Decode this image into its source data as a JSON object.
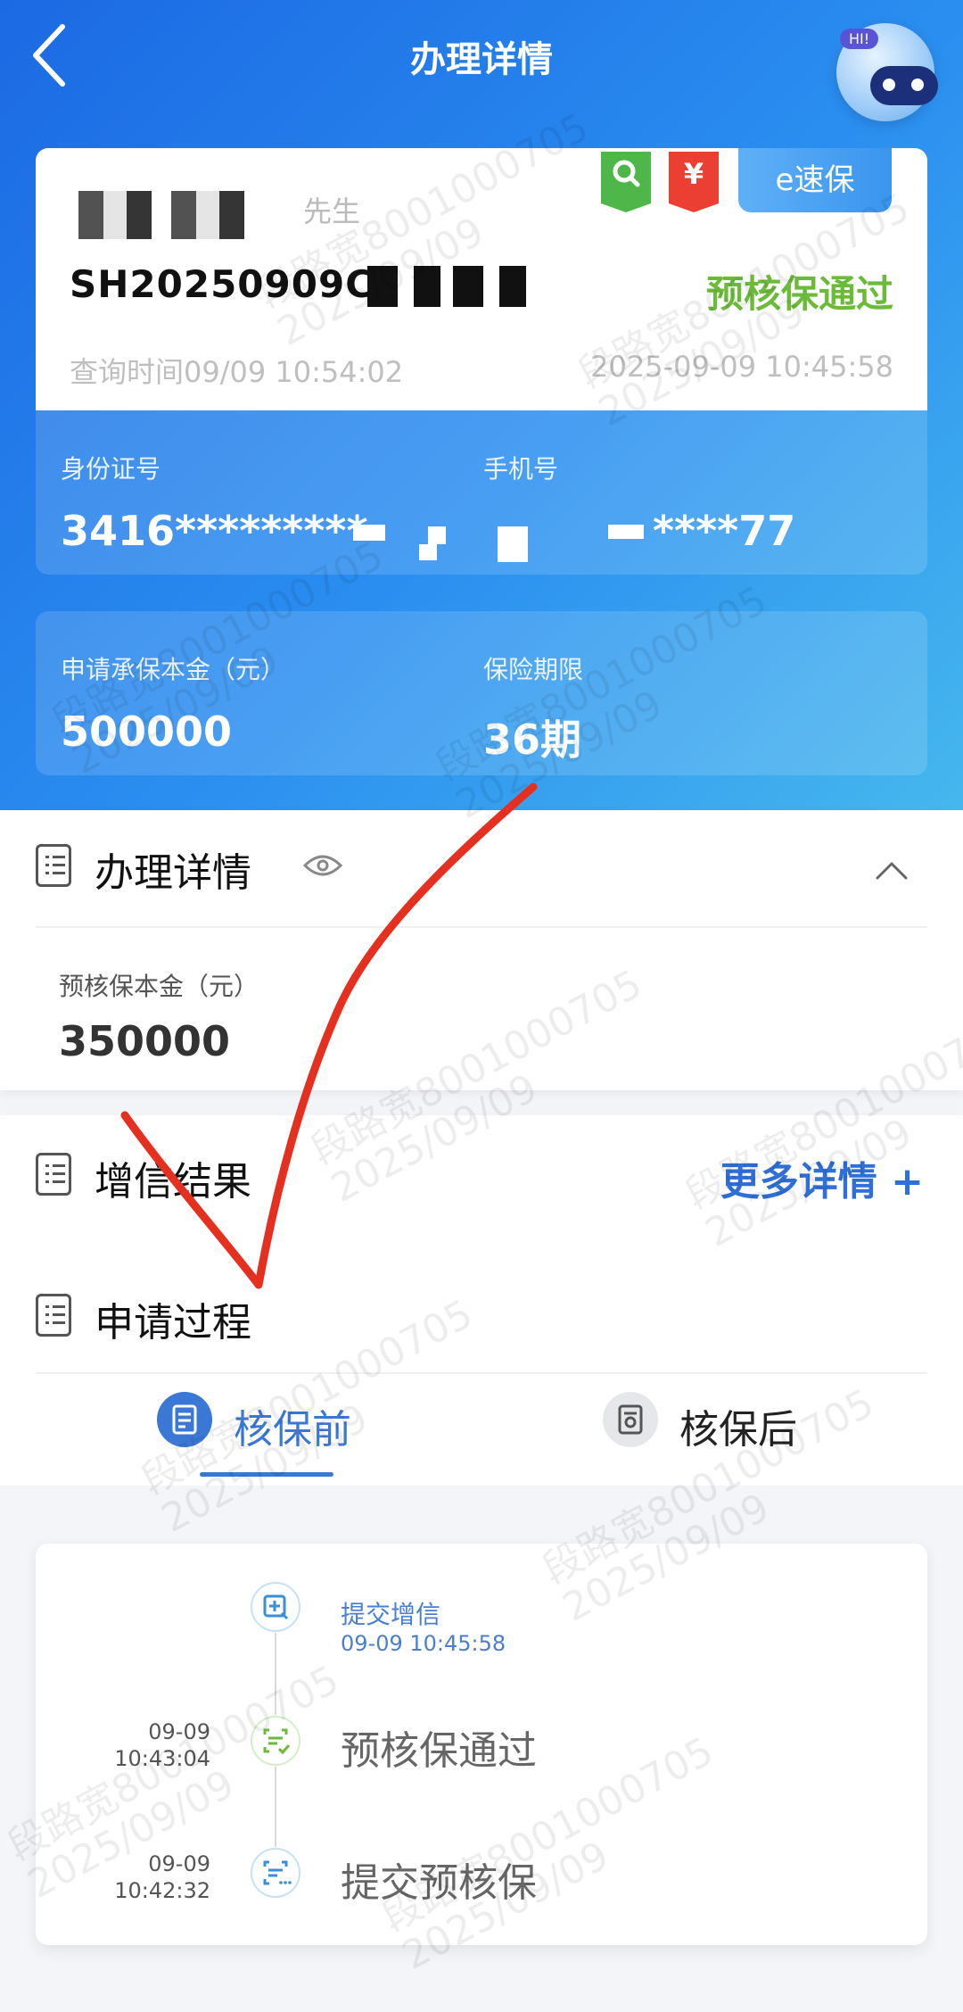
{
  "nav": {
    "title": "办理详情",
    "bot_greeting": "HI!"
  },
  "card": {
    "name_suffix": "先生",
    "policy_no": "SH20250909C",
    "status": "预核保通过",
    "query_time": "查询时间09/09 10:54:02",
    "created_time": "2025-09-09 10:45:58",
    "badge_search": "search-icon",
    "badge_money": "yen-icon",
    "esubao_label": "e速保"
  },
  "info": {
    "id_label": "身份证号",
    "id_value": "3416*********",
    "phone_label": "手机号",
    "phone_value": "****77",
    "amount_label": "申请承保本金（元）",
    "amount_value": "500000",
    "term_label": "保险期限",
    "term_value": "36期"
  },
  "details": {
    "title": "办理详情",
    "precheck_label": "预核保本金（元）",
    "precheck_value": "350000"
  },
  "credit": {
    "title": "增信结果",
    "more": "更多详情 +"
  },
  "process": {
    "title": "申请过程",
    "tabs": [
      {
        "label": "核保前",
        "active": true
      },
      {
        "label": "核保后",
        "active": false
      }
    ]
  },
  "timeline": [
    {
      "title": "提交增信",
      "time": "09-09 10:45:58",
      "date": "",
      "clock": ""
    },
    {
      "title": "预核保通过",
      "time": "",
      "date": "09-09",
      "clock": "10:43:04"
    },
    {
      "title": "提交预核保",
      "time": "",
      "date": "09-09",
      "clock": "10:42:32"
    }
  ],
  "watermark": {
    "line1": "段路宽8001000705",
    "line2": "2025/09/09"
  },
  "colors": {
    "primary": "#2f6fd6",
    "success": "#6bbb39",
    "hero_start": "#1c69e3",
    "hero_end": "#46b7ee"
  }
}
